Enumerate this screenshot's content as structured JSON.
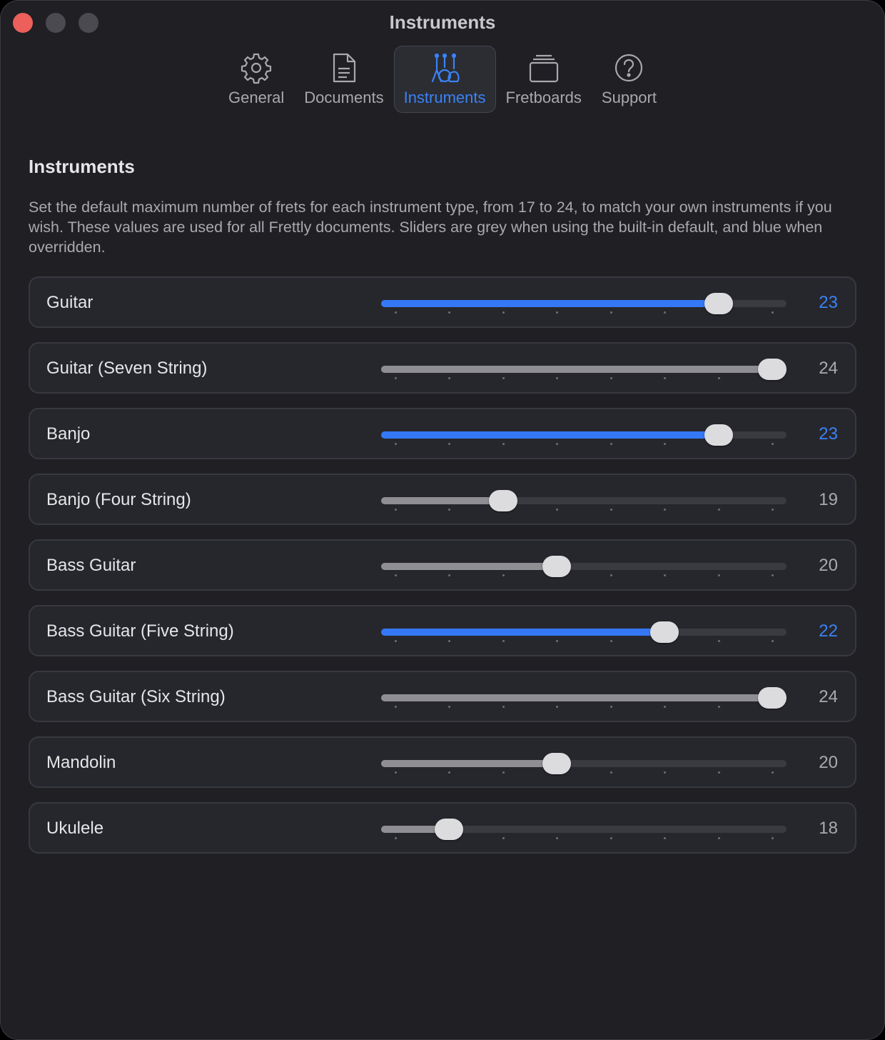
{
  "window": {
    "title": "Instruments"
  },
  "tabs": [
    {
      "label": "General",
      "icon": "gear-icon",
      "active": false
    },
    {
      "label": "Documents",
      "icon": "document-icon",
      "active": false
    },
    {
      "label": "Instruments",
      "icon": "instruments-icon",
      "active": true
    },
    {
      "label": "Fretboards",
      "icon": "stack-icon",
      "active": false
    },
    {
      "label": "Support",
      "icon": "question-circle-icon",
      "active": false
    }
  ],
  "section": {
    "title": "Instruments",
    "description": "Set the default maximum number of frets for each instrument type, from 17 to 24, to match your own instruments if you wish. These values are used for all Frettly documents. Sliders are grey when using the built-in default, and blue when overridden."
  },
  "slider_range": {
    "min": 17,
    "max": 24
  },
  "colors": {
    "accent": "#3478f6",
    "default_fill": "#8e8e93",
    "close": "#ec5f5a"
  },
  "instruments": [
    {
      "name": "Guitar",
      "value": 23,
      "overridden": true
    },
    {
      "name": "Guitar (Seven String)",
      "value": 24,
      "overridden": false
    },
    {
      "name": "Banjo",
      "value": 23,
      "overridden": true
    },
    {
      "name": "Banjo (Four String)",
      "value": 19,
      "overridden": false
    },
    {
      "name": "Bass Guitar",
      "value": 20,
      "overridden": false
    },
    {
      "name": "Bass Guitar (Five String)",
      "value": 22,
      "overridden": true
    },
    {
      "name": "Bass Guitar (Six String)",
      "value": 24,
      "overridden": false
    },
    {
      "name": "Mandolin",
      "value": 20,
      "overridden": false
    },
    {
      "name": "Ukulele",
      "value": 18,
      "overridden": false
    }
  ]
}
